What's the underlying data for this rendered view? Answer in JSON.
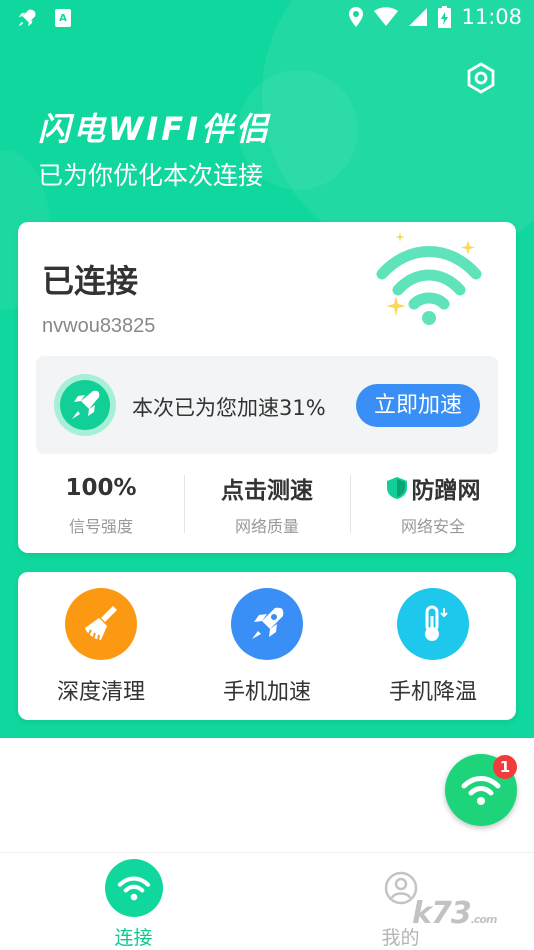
{
  "statusbar": {
    "time": "11:08",
    "left_icons": [
      "rocket-icon",
      "text-badge-icon"
    ],
    "right_icons": [
      "location-icon",
      "wifi-icon",
      "signal-icon",
      "battery-icon"
    ]
  },
  "header": {
    "title": "闪电WIFI伴侣",
    "subtitle": "已为你优化本次连接",
    "settings_icon": "settings-icon"
  },
  "connection": {
    "status": "已连接",
    "ssid": "nvwou83825"
  },
  "boost": {
    "text": "本次已为您加速31%",
    "button": "立即加速"
  },
  "stats": [
    {
      "value": "100%",
      "label": "信号强度"
    },
    {
      "value": "点击测速",
      "label": "网络质量"
    },
    {
      "value": "防蹭网",
      "label": "网络安全",
      "icon": "shield-icon"
    }
  ],
  "tools": [
    {
      "label": "深度清理",
      "icon": "broom-icon",
      "color": "#fb9a12"
    },
    {
      "label": "手机加速",
      "icon": "rocket-icon",
      "color": "#3a8ff6"
    },
    {
      "label": "手机降温",
      "icon": "thermometer-icon",
      "color": "#1ec7ec"
    }
  ],
  "floating": {
    "badge": "1",
    "color": "#1ed47b"
  },
  "nav": [
    {
      "label": "连接",
      "icon": "wifi-icon"
    },
    {
      "label": "我的",
      "icon": "user-icon"
    }
  ],
  "watermark": "k73",
  "watermark_suffix": ".com",
  "colors": {
    "brand": "#10d79d",
    "accent_blue": "#3a8ff6",
    "badge_red": "#f23b3b"
  }
}
